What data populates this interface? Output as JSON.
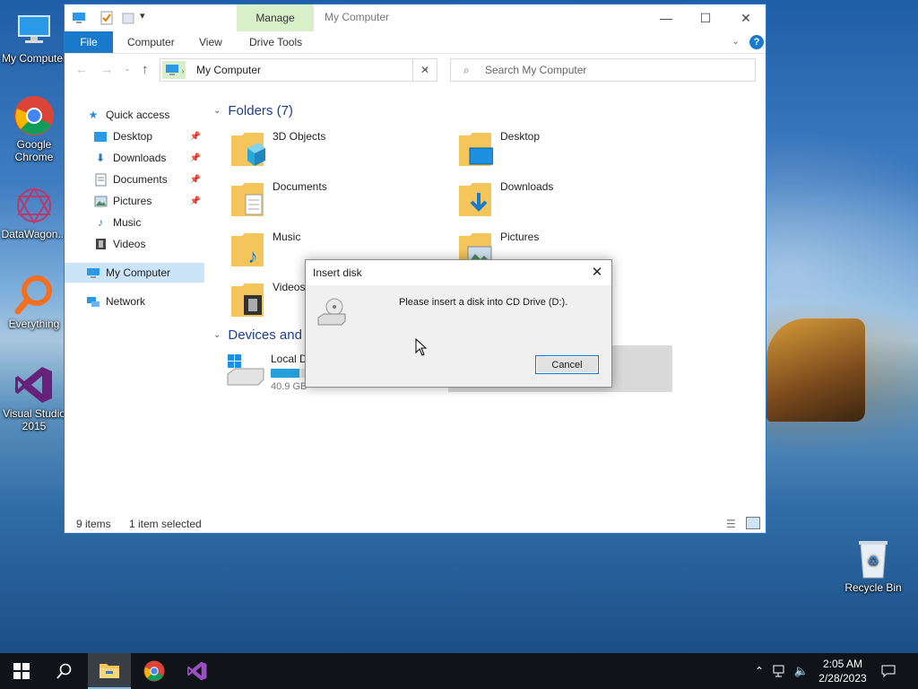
{
  "desktop": {
    "icons": [
      {
        "label": "My Computer",
        "icon": "computer-icon"
      },
      {
        "label": "Google Chrome",
        "icon": "chrome-icon"
      },
      {
        "label": "DataWagon...",
        "icon": "datawagon-icon"
      },
      {
        "label": "Everything",
        "icon": "search-magnifier-icon"
      },
      {
        "label": "Visual Studio 2015",
        "icon": "visual-studio-icon"
      },
      {
        "label": "Recycle Bin",
        "icon": "recycle-bin-icon"
      }
    ]
  },
  "explorer": {
    "title": "My Computer",
    "context_tab": "Manage",
    "ribbon_tabs": [
      "File",
      "Computer",
      "View",
      "Drive Tools"
    ],
    "address": "My Computer",
    "search_placeholder": "Search My Computer",
    "sidebar": [
      {
        "label": "Quick access",
        "icon": "star-icon",
        "pinned": false
      },
      {
        "label": "Desktop",
        "icon": "desktop-folder-icon",
        "pinned": true
      },
      {
        "label": "Downloads",
        "icon": "downloads-icon",
        "pinned": true
      },
      {
        "label": "Documents",
        "icon": "documents-icon",
        "pinned": true
      },
      {
        "label": "Pictures",
        "icon": "pictures-icon",
        "pinned": true
      },
      {
        "label": "Music",
        "icon": "music-icon",
        "pinned": false
      },
      {
        "label": "Videos",
        "icon": "videos-icon",
        "pinned": false
      },
      {
        "label": "My Computer",
        "icon": "computer-icon",
        "selected": true
      },
      {
        "label": "Network",
        "icon": "network-icon"
      }
    ],
    "folders_header": "Folders (7)",
    "folders": [
      "3D Objects",
      "Desktop",
      "Documents",
      "Downloads",
      "Music",
      "Pictures",
      "Videos"
    ],
    "devices_header": "Devices and d",
    "drive": {
      "name": "Local D",
      "size": "40.9 GB",
      "used_fraction": 0.45
    },
    "status": {
      "items": "9 items",
      "selected": "1 item selected"
    }
  },
  "dialog": {
    "title": "Insert disk",
    "message": "Please insert a disk into CD Drive (D:).",
    "cancel": "Cancel"
  },
  "taskbar": {
    "time": "2:05 AM",
    "date": "2/28/2023"
  },
  "colors": {
    "accent": "#1979ca",
    "manage_tab": "#d9efc9",
    "selection": "#cce4f7"
  }
}
